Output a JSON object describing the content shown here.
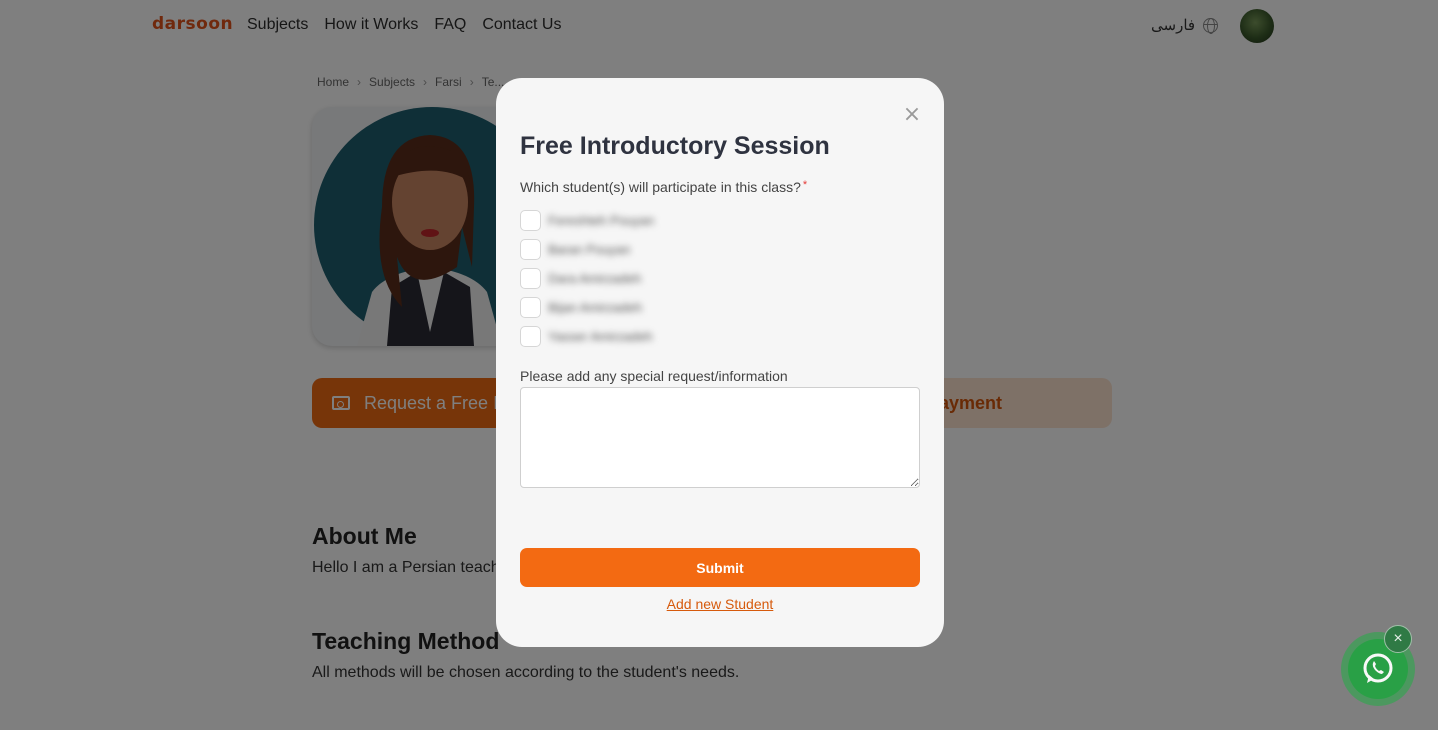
{
  "header": {
    "logo": "darsoon",
    "nav": [
      "Subjects",
      "How it Works",
      "FAQ",
      "Contact Us"
    ],
    "language": "فارسی"
  },
  "breadcrumb": [
    "Home",
    "Subjects",
    "Farsi",
    "Te..."
  ],
  "actions": {
    "request_label": "Request a Free In",
    "payment_label": "ayment"
  },
  "about": {
    "title": "About Me",
    "text": "Hello I am a Persian teache"
  },
  "teaching": {
    "title": "Teaching Method",
    "text": "All methods will be chosen according to the student's needs."
  },
  "modal": {
    "title": "Free Introductory Session",
    "question": "Which student(s) will participate in this class?",
    "required_mark": "*",
    "students": [
      "Fereshteh Pouyan",
      "Baran Pouyan",
      "Dara Amirzadeh",
      "Bijan Amirzadeh",
      "Yasser Amirzadeh"
    ],
    "special_label": "Please add any special request/information",
    "special_value": "",
    "submit_label": "Submit",
    "add_student_label": "Add new Student",
    "close_symbol": "×"
  },
  "whatsapp": {
    "close_symbol": "×"
  },
  "colors": {
    "brand": "#ef6a12",
    "overlay": "rgba(0,0,0,0.5)",
    "whatsapp": "#25a244"
  }
}
